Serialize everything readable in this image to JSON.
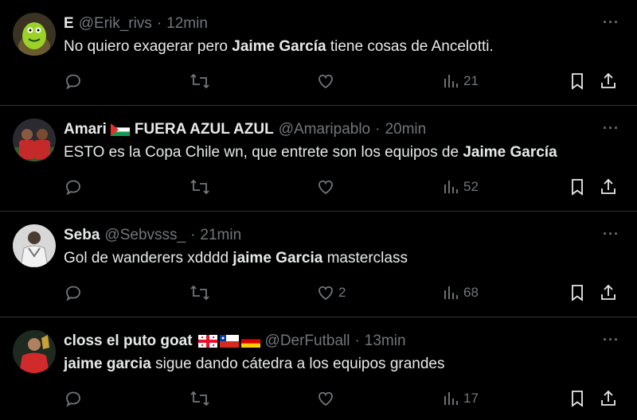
{
  "tweets": [
    {
      "name": "E",
      "handle": "@Erik_rivs",
      "time": "12min",
      "text_before": "No quiero exagerar pero ",
      "text_bold": "Jaime García",
      "text_after": " tiene cosas de Ancelotti.",
      "likes": "",
      "views": "21"
    },
    {
      "name": "Amari",
      "name_suffix": "FUERA AZUL AZUL",
      "handle": "@Amaripablo",
      "time": "20min",
      "text_before": "ESTO es la Copa Chile wn, que entrete son los equipos de ",
      "text_bold": "Jaime García",
      "text_after": "",
      "likes": "",
      "views": "52"
    },
    {
      "name": "Seba",
      "handle": "@Sebvsss_",
      "time": "21min",
      "text_before": "Gol de wanderers xdddd ",
      "text_bold": "jaime Garcia",
      "text_after": " masterclass",
      "likes": "2",
      "views": "68"
    },
    {
      "name": "closs el puto goat",
      "handle": "@DerFutball",
      "time": "13min",
      "text_before": "",
      "text_bold": "jaime garcia",
      "text_after": " sigue dando cátedra a los equipos grandes",
      "likes": "",
      "views": "17"
    }
  ],
  "ui": {
    "dot": "·",
    "more": "···"
  },
  "colors": {
    "background": "#000000",
    "text": "#e7e9ea",
    "muted": "#71767b",
    "divider": "#2f3336"
  },
  "icons": [
    "reply-icon",
    "retweet-icon",
    "like-icon",
    "views-icon",
    "bookmark-icon",
    "share-icon",
    "more-icon",
    "palestine-flag-icon",
    "georgia-flag-icon",
    "chile-flag-icon",
    "germany-flag-icon"
  ]
}
